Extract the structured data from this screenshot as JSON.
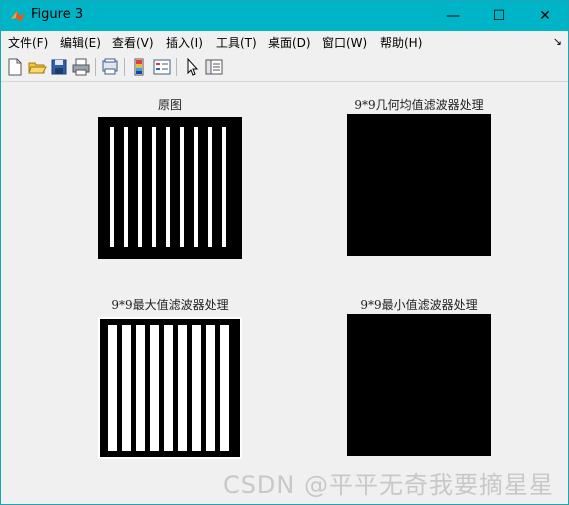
{
  "window": {
    "title": "Figure 3",
    "controls": {
      "minimize": "—",
      "maximize": "☐",
      "close": "✕"
    }
  },
  "menu": {
    "items": [
      "文件(F)",
      "编辑(E)",
      "查看(V)",
      "插入(I)",
      "工具(T)",
      "桌面(D)",
      "窗口(W)",
      "帮助(H)"
    ],
    "overflow": "↘"
  },
  "toolbar": {
    "icons": [
      "new-figure-icon",
      "open-file-icon",
      "save-icon",
      "print-icon",
      "print-preview-icon",
      "colorbar-icon",
      "legend-icon",
      "pointer-icon",
      "property-editor-icon"
    ]
  },
  "plots": [
    {
      "title": "原图",
      "content": "stripes"
    },
    {
      "title": "9*9几何均值滤波器处理",
      "content": "black"
    },
    {
      "title": "9*9最大值滤波器处理",
      "content": "wide-stripes"
    },
    {
      "title": "9*9最小值滤波器处理",
      "content": "black"
    }
  ],
  "watermark": "CSDN @平平无奇我要摘星星",
  "colors": {
    "titlebar": "#00b4c8",
    "background": "#f0f0f0"
  }
}
